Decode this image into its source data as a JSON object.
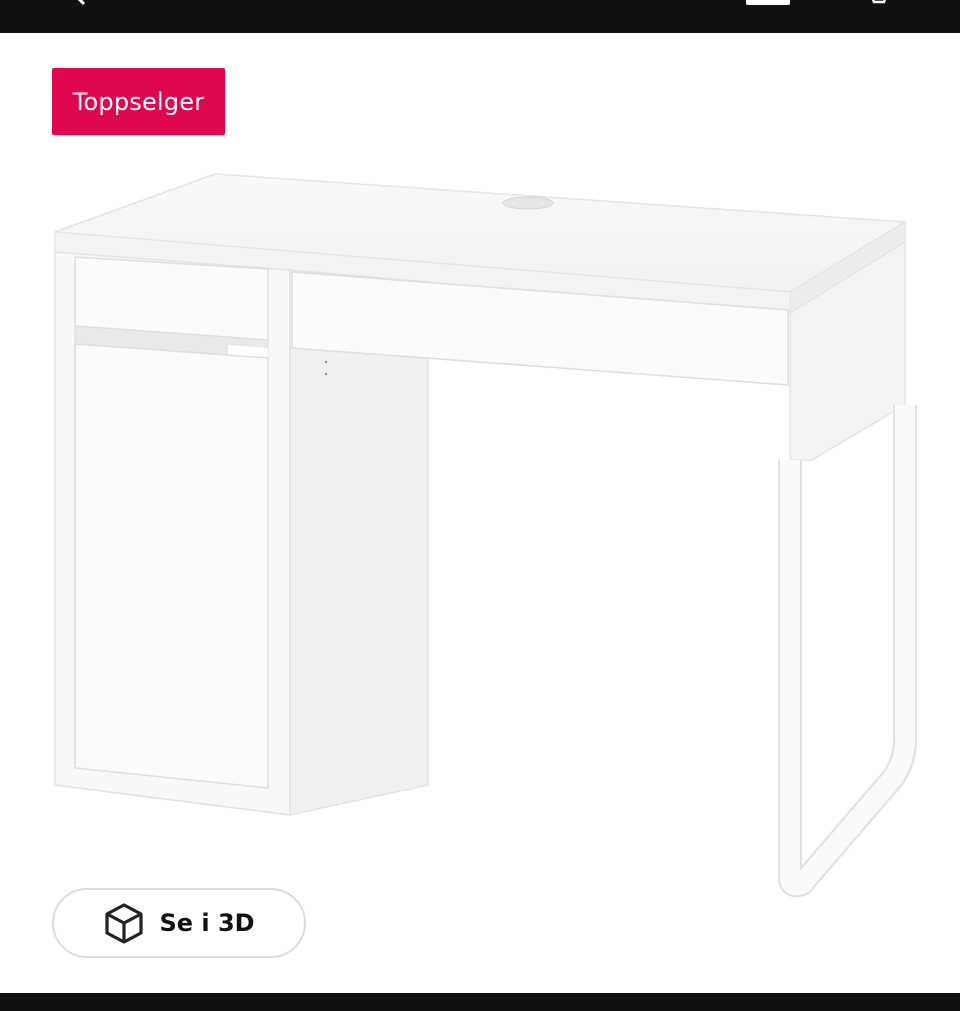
{
  "badge": {
    "label": "Toppselger",
    "color": "#e00751"
  },
  "view3d": {
    "label": "Se i 3D",
    "icon": "cube-3d-icon"
  },
  "topbar": {
    "icons": [
      "back-chevron-icon",
      "cart-icon"
    ]
  },
  "product": {
    "image": "white desk with drawers and cabinet"
  }
}
